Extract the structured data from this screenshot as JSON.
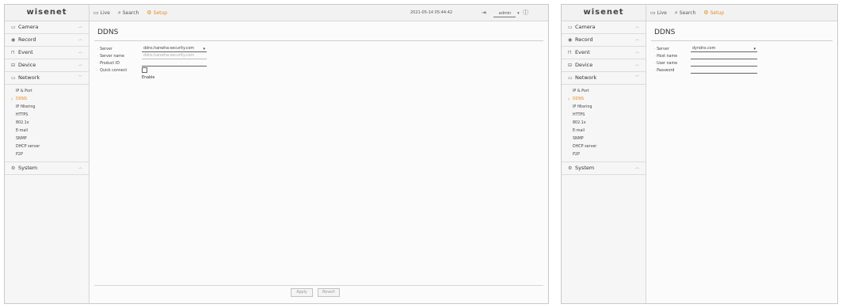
{
  "app": {
    "logo": "wisenet"
  },
  "nav": {
    "live": "Live",
    "search": "Search",
    "setup": "Setup"
  },
  "status": {
    "datetime": "2021-05-14 05:44:42",
    "user": "admin"
  },
  "sidebar": {
    "menus": [
      "Camera",
      "Record",
      "Event",
      "Device",
      "Network",
      "System"
    ],
    "network_items": [
      "IP & Port",
      "DDNS",
      "IP filtering",
      "HTTPS",
      "802.1x",
      "E-mail",
      "SNMP",
      "DHCP server",
      "P2P"
    ]
  },
  "panel1": {
    "title": "DDNS",
    "fields": {
      "server": {
        "label": "Server",
        "value": "ddns.hanwha-security.com"
      },
      "server_name": {
        "label": "Server name",
        "placeholder": "ddns.hanwha-security.com"
      },
      "product_id": {
        "label": "Product ID",
        "value": ""
      },
      "quick_connect": {
        "label": "Quick connect",
        "option": "Enable"
      }
    },
    "buttons": {
      "apply": "Apply",
      "revert": "Revert"
    }
  },
  "panel2": {
    "title": "DDNS",
    "fields": {
      "server": {
        "label": "Server",
        "value": "dyndns.com"
      },
      "host_name": {
        "label": "Host name",
        "value": ""
      },
      "user_name": {
        "label": "User name",
        "value": ""
      },
      "password": {
        "label": "Password",
        "value": ""
      }
    }
  }
}
